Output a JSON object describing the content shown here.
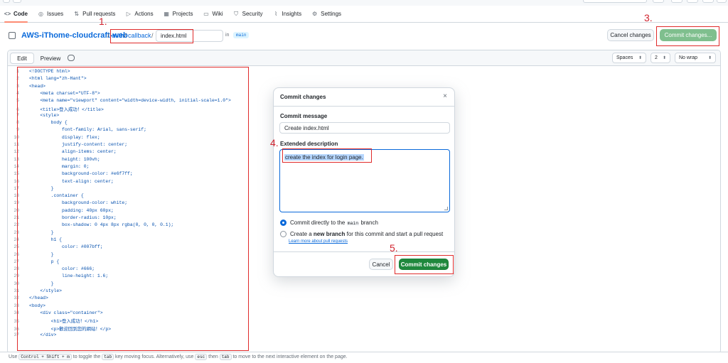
{
  "nav": {
    "items": [
      {
        "label": "Code",
        "icon": "code-icon",
        "glyph": "<>"
      },
      {
        "label": "Issues",
        "icon": "issues-icon",
        "glyph": "◎"
      },
      {
        "label": "Pull requests",
        "icon": "pull-request-icon",
        "glyph": "⇅"
      },
      {
        "label": "Actions",
        "icon": "actions-icon",
        "glyph": "▷"
      },
      {
        "label": "Projects",
        "icon": "projects-icon",
        "glyph": "▦"
      },
      {
        "label": "Wiki",
        "icon": "wiki-icon",
        "glyph": "▭"
      },
      {
        "label": "Security",
        "icon": "shield-icon",
        "glyph": "⛉"
      },
      {
        "label": "Insights",
        "icon": "graph-icon",
        "glyph": "⌇"
      },
      {
        "label": "Settings",
        "icon": "gear-icon",
        "glyph": "⚙"
      }
    ]
  },
  "file_header": {
    "repo": "AWS-iThome-cloudcraft-web",
    "path_segments": [
      "auth",
      "callback"
    ],
    "slash": "/",
    "filename": "index.html",
    "in_label": "in",
    "branch": "main",
    "cancel_label": "Cancel changes",
    "commit_label": "Commit changes..."
  },
  "annotations": {
    "a1": "1.",
    "a2": "2.",
    "a3": "3.",
    "a4": "4.",
    "a5": "5."
  },
  "editor": {
    "tab_edit": "Edit",
    "tab_preview": "Preview",
    "indent_mode": "Spaces",
    "indent_size": "2",
    "wrap_mode": "No wrap",
    "caret": "⬍",
    "lines": [
      "<!DOCTYPE html>",
      "<html lang=\"zh-Hant\">",
      "<head>",
      "    <meta charset=\"UTF-8\">",
      "    <meta name=\"viewport\" content=\"width=device-width, initial-scale=1.0\">",
      "    <title>登入成功！</title>",
      "    <style>",
      "        body {",
      "            font-family: Arial, sans-serif;",
      "            display: flex;",
      "            justify-content: center;",
      "            align-items: center;",
      "            height: 100vh;",
      "            margin: 0;",
      "            background-color: #e6f7ff;",
      "            text-align: center;",
      "        }",
      "        .container {",
      "            background-color: white;",
      "            padding: 40px 60px;",
      "            border-radius: 10px;",
      "            box-shadow: 0 4px 8px rgba(0, 0, 0, 0.1);",
      "        }",
      "        h1 {",
      "            color: #007bff;",
      "        }",
      "        p {",
      "            color: #666;",
      "            line-height: 1.6;",
      "        }",
      "    </style>",
      "</head>",
      "<body>",
      "    <div class=\"container\">",
      "        <h1>登入成功！</h1>",
      "        <p>歡迎回到您的網站！</p>",
      "    </div>"
    ]
  },
  "footer": {
    "p1": "Use",
    "k1": "Control + Shift + m",
    "p2": "to toggle the",
    "k2": "tab",
    "p3": "key moving focus. Alternatively, use",
    "k3": "esc",
    "p4": "then",
    "k4": "tab",
    "p5": "to move to the next interactive element on the page."
  },
  "modal": {
    "title": "Commit changes",
    "close": "×",
    "message_label": "Commit message",
    "message_value": "Create index.html",
    "description_label": "Extended description",
    "description_value": "create the index for login page.",
    "option1_pre": "Commit directly to the",
    "option1_branch": "main",
    "option1_post": "branch",
    "option2_pre": "Create a",
    "option2_bold": "new branch",
    "option2_post": "for this commit and start a pull request",
    "learn_more": "Learn more about pull requests",
    "cancel_label": "Cancel",
    "commit_label": "Commit changes"
  },
  "colors": {
    "accent_blue": "#0969da",
    "green": "#1f883d",
    "annotation_red": "#d1242f"
  }
}
